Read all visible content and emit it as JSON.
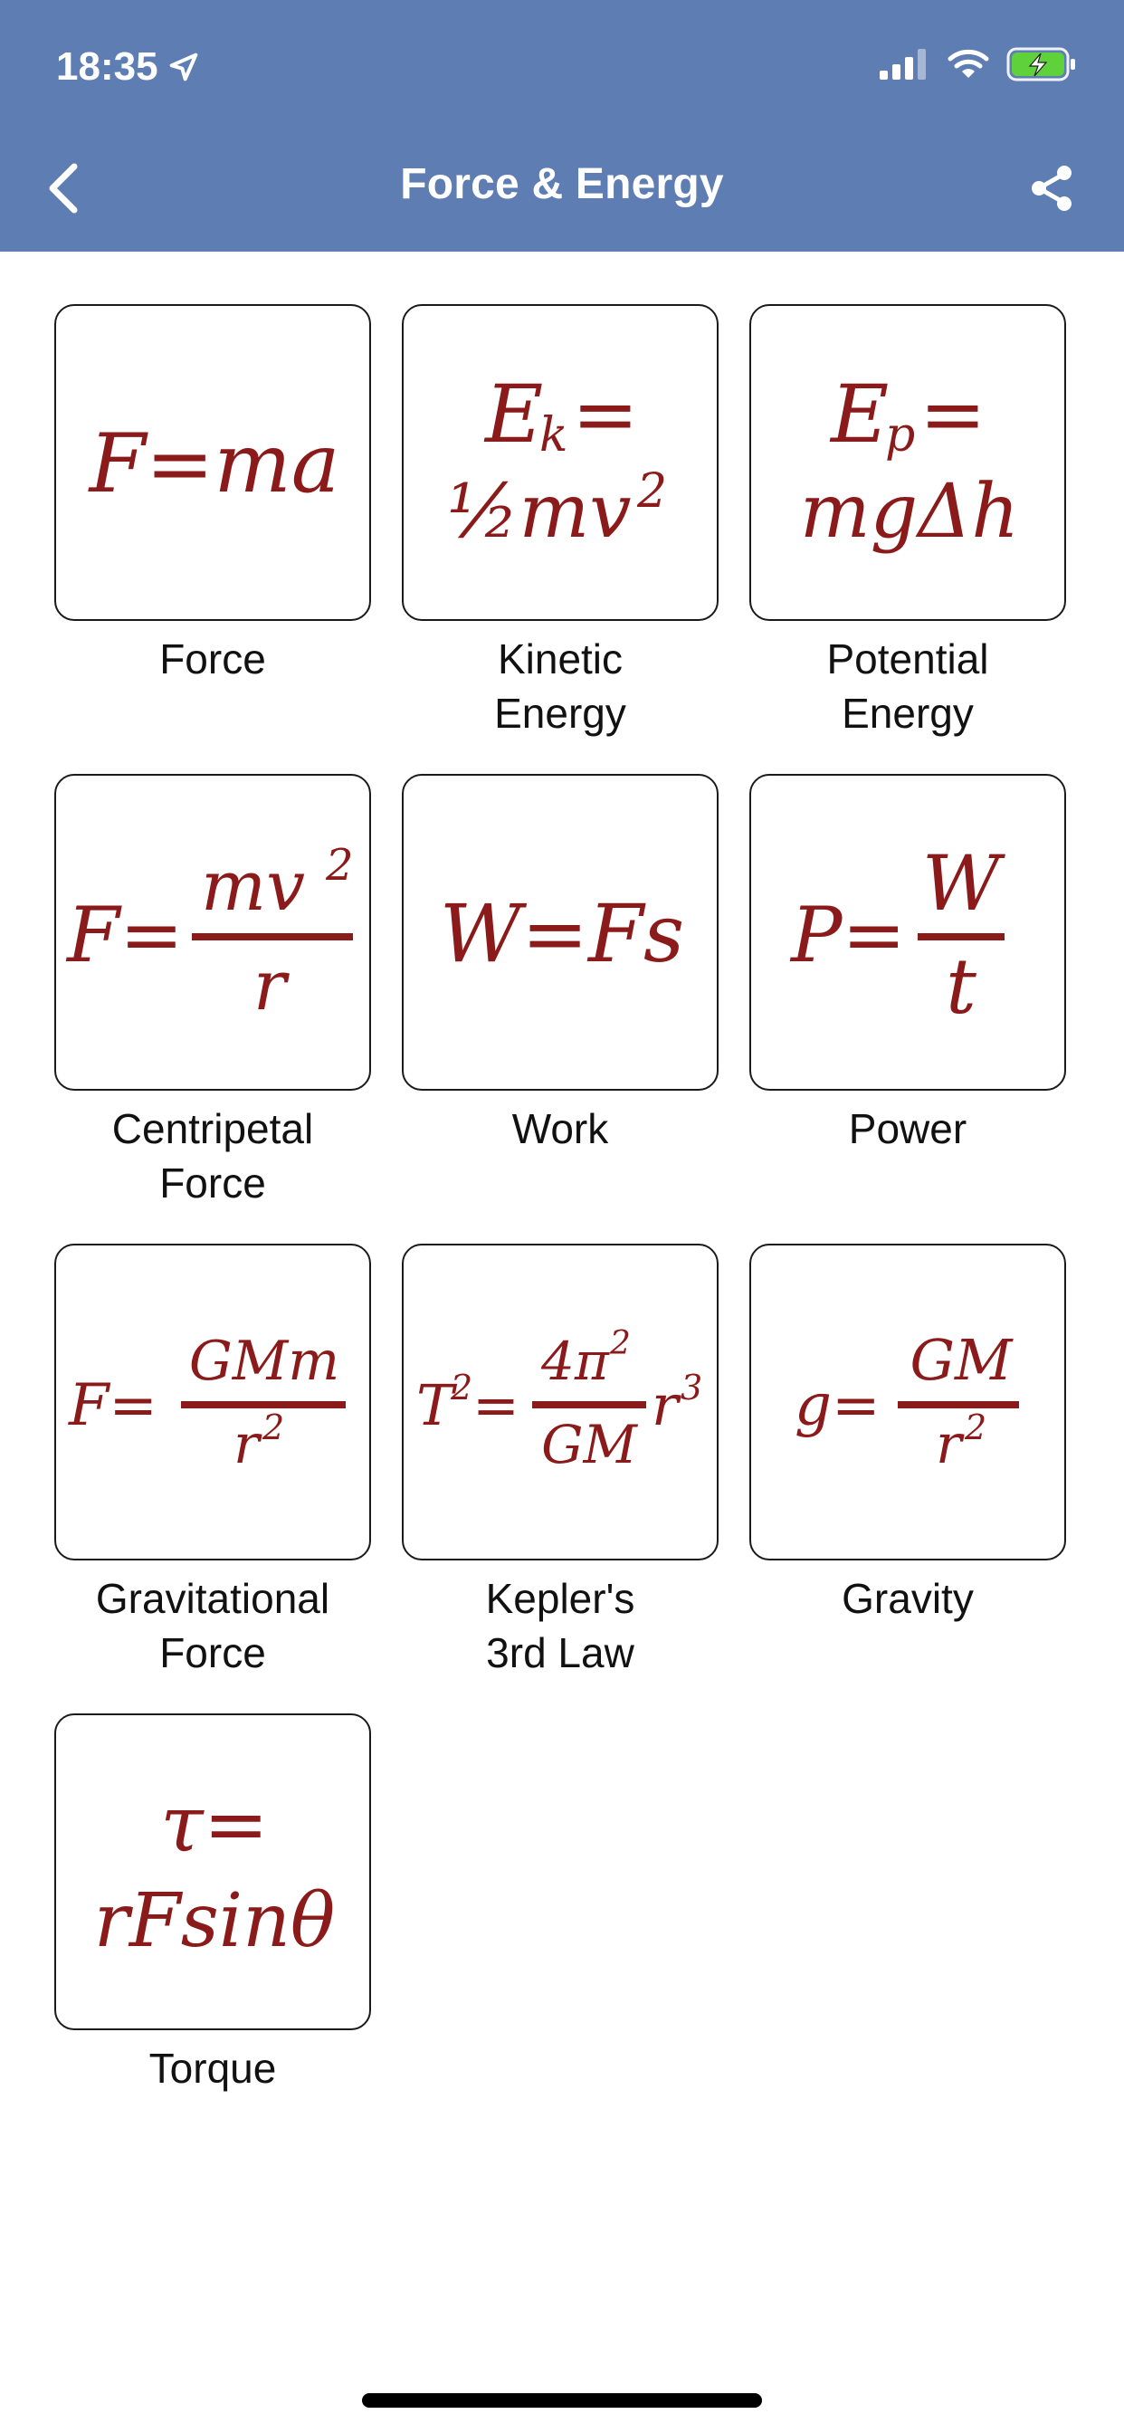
{
  "status_bar": {
    "time": "18:35"
  },
  "header": {
    "title": "Force & Energy"
  },
  "colors": {
    "header_bg": "#5d7db3",
    "formula": "#8b1a1a"
  },
  "formulas": [
    {
      "label": "Force",
      "parts": [
        "F=ma"
      ]
    },
    {
      "label": "Kinetic\nEnergy",
      "parts": [
        "E",
        "k",
        "=",
        "½mv",
        "2"
      ]
    },
    {
      "label": "Potential\nEnergy",
      "parts": [
        "E",
        "p",
        "=",
        "mgΔh"
      ]
    },
    {
      "label": "Centripetal\nForce",
      "parts": [
        "F=",
        "mv",
        "2",
        "r"
      ]
    },
    {
      "label": "Work",
      "parts": [
        "W=Fs"
      ]
    },
    {
      "label": "Power",
      "parts": [
        "P=",
        "W",
        "t"
      ]
    },
    {
      "label": "Gravitational\nForce",
      "parts": [
        "F=",
        "GMm",
        "r",
        "2"
      ]
    },
    {
      "label": "Kepler's\n3rd Law",
      "parts": [
        "T",
        "2",
        "=",
        "4π",
        "2",
        "GM",
        "r",
        "3"
      ]
    },
    {
      "label": "Gravity",
      "parts": [
        "g=",
        "GM",
        "r",
        "2"
      ]
    },
    {
      "label": "Torque",
      "parts": [
        "τ=",
        "rFsinθ"
      ]
    }
  ]
}
